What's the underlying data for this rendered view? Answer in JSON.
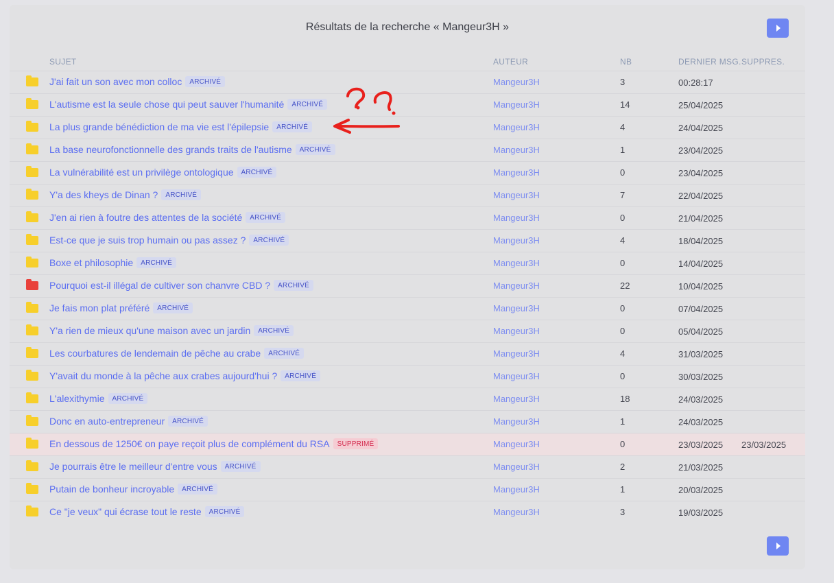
{
  "title": "Résultats de la recherche « Mangeur3H »",
  "headers": {
    "sujet": "SUJET",
    "auteur": "AUTEUR",
    "nb": "NB",
    "dernier": "DERNIER MSG.",
    "suppr": "SUPPRES."
  },
  "colors": {
    "accent": "#6f86f2",
    "folder": "#f7cf2b",
    "folder_hot": "#e9413b",
    "annotation": "#e8201c"
  },
  "rows": [
    {
      "subject": "J'ai fait un son avec mon colloc",
      "badge": "ARCHIVÉ",
      "author": "Mangeur3H",
      "nb": "3",
      "date": "00:28:17",
      "suppr": ""
    },
    {
      "subject": "L'autisme est la seule chose qui peut sauver l'humanité",
      "badge": "ARCHIVÉ",
      "author": "Mangeur3H",
      "nb": "14",
      "date": "25/04/2025",
      "suppr": ""
    },
    {
      "subject": "La plus grande bénédiction de ma vie est l'épilepsie",
      "badge": "ARCHIVÉ",
      "author": "Mangeur3H",
      "nb": "4",
      "date": "24/04/2025",
      "suppr": ""
    },
    {
      "subject": "La base neurofonctionnelle des grands traits de l'autisme",
      "badge": "ARCHIVÉ",
      "author": "Mangeur3H",
      "nb": "1",
      "date": "23/04/2025",
      "suppr": ""
    },
    {
      "subject": "La vulnérabilité est un privilège ontologique",
      "badge": "ARCHIVÉ",
      "author": "Mangeur3H",
      "nb": "0",
      "date": "23/04/2025",
      "suppr": ""
    },
    {
      "subject": "Y'a des kheys de Dinan ?",
      "badge": "ARCHIVÉ",
      "author": "Mangeur3H",
      "nb": "7",
      "date": "22/04/2025",
      "suppr": ""
    },
    {
      "subject": "J'en ai rien à foutre des attentes de la société",
      "badge": "ARCHIVÉ",
      "author": "Mangeur3H",
      "nb": "0",
      "date": "21/04/2025",
      "suppr": ""
    },
    {
      "subject": "Est-ce que je suis trop humain ou pas assez ?",
      "badge": "ARCHIVÉ",
      "author": "Mangeur3H",
      "nb": "4",
      "date": "18/04/2025",
      "suppr": ""
    },
    {
      "subject": "Boxe et philosophie",
      "badge": "ARCHIVÉ",
      "author": "Mangeur3H",
      "nb": "0",
      "date": "14/04/2025",
      "suppr": ""
    },
    {
      "subject": "Pourquoi est-il illégal de cultiver son chanvre CBD ?",
      "badge": "ARCHIVÉ",
      "author": "Mangeur3H",
      "nb": "22",
      "date": "10/04/2025",
      "suppr": "",
      "hot": true
    },
    {
      "subject": "Je fais mon plat préféré",
      "badge": "ARCHIVÉ",
      "author": "Mangeur3H",
      "nb": "0",
      "date": "07/04/2025",
      "suppr": ""
    },
    {
      "subject": "Y'a rien de mieux qu'une maison avec un jardin",
      "badge": "ARCHIVÉ",
      "author": "Mangeur3H",
      "nb": "0",
      "date": "05/04/2025",
      "suppr": ""
    },
    {
      "subject": "Les courbatures de lendemain de pêche au crabe",
      "badge": "ARCHIVÉ",
      "author": "Mangeur3H",
      "nb": "4",
      "date": "31/03/2025",
      "suppr": ""
    },
    {
      "subject": "Y'avait du monde à la pêche aux crabes aujourd'hui ?",
      "badge": "ARCHIVÉ",
      "author": "Mangeur3H",
      "nb": "0",
      "date": "30/03/2025",
      "suppr": ""
    },
    {
      "subject": "L'alexithymie",
      "badge": "ARCHIVÉ",
      "author": "Mangeur3H",
      "nb": "18",
      "date": "24/03/2025",
      "suppr": ""
    },
    {
      "subject": "Donc en auto-entrepreneur",
      "badge": "ARCHIVÉ",
      "author": "Mangeur3H",
      "nb": "1",
      "date": "24/03/2025",
      "suppr": ""
    },
    {
      "subject": "En dessous de 1250€ on paye reçoit plus de complément du RSA",
      "badge": "SUPPRIMÉ",
      "author": "Mangeur3H",
      "nb": "0",
      "date": "23/03/2025",
      "suppr": "23/03/2025",
      "deleted": true
    },
    {
      "subject": "Je pourrais être le meilleur d'entre vous",
      "badge": "ARCHIVÉ",
      "author": "Mangeur3H",
      "nb": "2",
      "date": "21/03/2025",
      "suppr": ""
    },
    {
      "subject": "Putain de bonheur incroyable",
      "badge": "ARCHIVÉ",
      "author": "Mangeur3H",
      "nb": "1",
      "date": "20/03/2025",
      "suppr": ""
    },
    {
      "subject": "Ce \"je veux\" qui écrase tout le reste",
      "badge": "ARCHIVÉ",
      "author": "Mangeur3H",
      "nb": "3",
      "date": "19/03/2025",
      "suppr": ""
    }
  ],
  "icons": {
    "nav": "play-triangle-icon",
    "folder": "folder-icon",
    "annotation": "hand-drawn-question-arrow"
  }
}
